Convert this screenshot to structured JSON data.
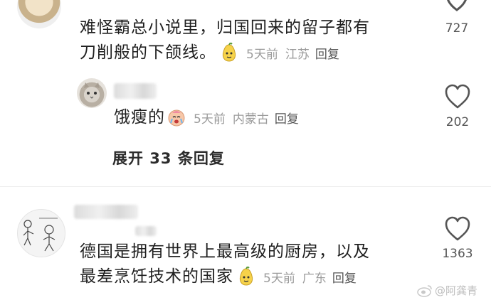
{
  "comments": [
    {
      "text_lines": [
        "难怪霸总小说里，归国回来的留子都有",
        "刀削般的下颌线。"
      ],
      "time": "5天前",
      "location": "江苏",
      "reply_label": "回复",
      "like_count": "727"
    },
    {
      "text_lines": [
        "饿瘦的"
      ],
      "time": "5天前",
      "location": "内蒙古",
      "reply_label": "回复",
      "like_count": "202"
    },
    {
      "text_lines": [
        "德国是拥有世界上最高级的厨房，以及",
        "最差烹饪技术的国家"
      ],
      "time": "5天前",
      "location": "广东",
      "reply_label": "回复",
      "like_count": "1363"
    }
  ],
  "expand_replies": "展开 33 条回复",
  "watermark": "@阿龚青"
}
